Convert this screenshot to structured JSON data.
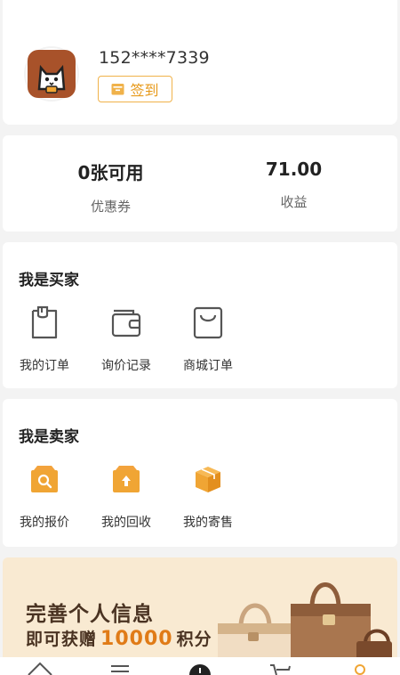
{
  "profile": {
    "phone": "152****7339",
    "checkin_label": "签到"
  },
  "stats": [
    {
      "value": "0张可用",
      "label": "优惠券"
    },
    {
      "value": "71.00",
      "label": "收益"
    }
  ],
  "buyer": {
    "title": "我是买家",
    "items": [
      {
        "label": "我的订单",
        "icon": "clipboard-icon"
      },
      {
        "label": "询价记录",
        "icon": "wallet-icon"
      },
      {
        "label": "商城订单",
        "icon": "shopping-bag-icon"
      }
    ]
  },
  "seller": {
    "title": "我是卖家",
    "items": [
      {
        "label": "我的报价",
        "icon": "quote-box-icon"
      },
      {
        "label": "我的回收",
        "icon": "recycle-box-icon"
      },
      {
        "label": "我的寄售",
        "icon": "consign-box-icon"
      }
    ]
  },
  "banner": {
    "line1": "完善个人信息",
    "line2_prefix": "即可获赠",
    "points": "10000",
    "line2_suffix": "积分"
  },
  "tabbar": [
    "home-icon",
    "list-icon",
    "center-icon",
    "cart-icon",
    "profile-icon"
  ],
  "colors": {
    "accent": "#f0a534",
    "brand_text": "#e79a1b",
    "banner_bg": "#f9ead2"
  }
}
